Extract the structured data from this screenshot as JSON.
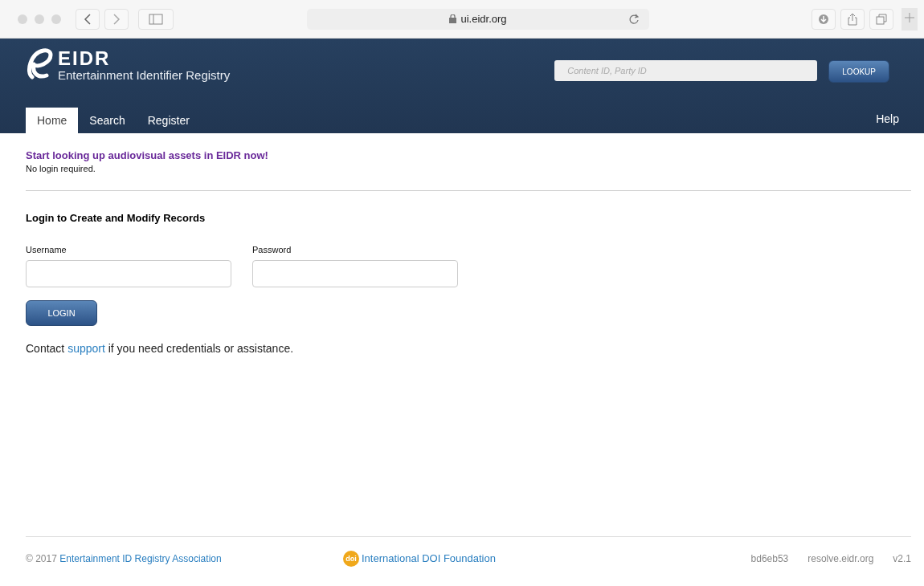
{
  "browser": {
    "url": "ui.eidr.org"
  },
  "header": {
    "logo_wordmark": "EIDR",
    "logo_tagline": "Entertainment Identifier Registry",
    "lookup": {
      "placeholder": "Content ID, Party ID",
      "button": "LOOKUP"
    }
  },
  "tabs": [
    {
      "label": "Home",
      "selected": true
    },
    {
      "label": "Search",
      "selected": false
    },
    {
      "label": "Register",
      "selected": false
    }
  ],
  "help_link": "Help",
  "intro": {
    "headline": "Start looking up audiovisual assets in EIDR now!",
    "note": "No login required."
  },
  "login": {
    "heading": "Login to Create and Modify Records",
    "fields": [
      {
        "label": "Username"
      },
      {
        "label": "Password"
      }
    ],
    "button": "LOGIN",
    "contact_before": "Contact",
    "contact_link": "support",
    "contact_after": "if you need credentials or assistance."
  },
  "footer": {
    "copyright": "© 2017",
    "association_link": "Entertainment ID Registry Association",
    "doi_badge": "doi",
    "doi_link": "International DOI Foundation",
    "build": "bd6eb53",
    "resolver": "resolve.eidr.org",
    "version": "v2.1"
  }
}
